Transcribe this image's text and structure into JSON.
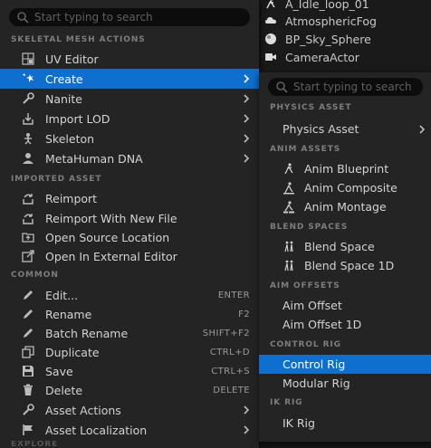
{
  "outliner": {
    "rows": [
      {
        "label": "A_Idle_loop_01",
        "icon": "running-figure-icon"
      },
      {
        "label": "AtmosphericFog",
        "icon": "cloud-icon"
      },
      {
        "label": "BP_Sky_Sphere",
        "icon": "sphere-icon"
      },
      {
        "label": "CameraActor",
        "icon": "camera-icon"
      }
    ]
  },
  "main_menu": {
    "search_placeholder": "Start typing to search",
    "sections": {
      "skeletal": "SKELETAL MESH ACTIONS",
      "imported": "IMPORTED ASSET",
      "common": "COMMON",
      "partial": "EXPLORE"
    },
    "items": {
      "uv_editor": "UV Editor",
      "create": "Create",
      "nanite": "Nanite",
      "import_lod": "Import LOD",
      "skeleton": "Skeleton",
      "metahuman": "MetaHuman DNA",
      "reimport": "Reimport",
      "reimport_new": "Reimport With New File",
      "open_source": "Open Source Location",
      "open_external": "Open In External Editor",
      "edit": "Edit...",
      "rename": "Rename",
      "batch_rename": "Batch Rename",
      "duplicate": "Duplicate",
      "save": "Save",
      "delete": "Delete",
      "asset_actions": "Asset Actions",
      "asset_localization": "Asset Localization"
    },
    "shortcuts": {
      "edit": "ENTER",
      "rename": "F2",
      "batch_rename": "SHIFT+F2",
      "duplicate": "CTRL+D",
      "save": "CTRL+S",
      "delete": "DELETE"
    }
  },
  "sub_menu": {
    "search_placeholder": "Start typing to search",
    "sections": {
      "physics": "PHYSICS ASSET",
      "anim": "ANIM ASSETS",
      "blend": "BLEND SPACES",
      "aim": "AIM OFFSETS",
      "control": "CONTROL RIG",
      "ik": "IK RIG"
    },
    "items": {
      "physics_asset": "Physics Asset",
      "anim_blueprint": "Anim Blueprint",
      "anim_composite": "Anim Composite",
      "anim_montage": "Anim Montage",
      "blend_space": "Blend Space",
      "blend_space_1d": "Blend Space 1D",
      "aim_offset": "Aim Offset",
      "aim_offset_1d": "Aim Offset 1D",
      "control_rig": "Control Rig",
      "modular_rig": "Modular Rig",
      "ik_rig": "IK Rig"
    }
  },
  "colors": {
    "selection": "#0e6fcf",
    "menu_bg": "#242424",
    "section_text": "#7d7d7d"
  }
}
